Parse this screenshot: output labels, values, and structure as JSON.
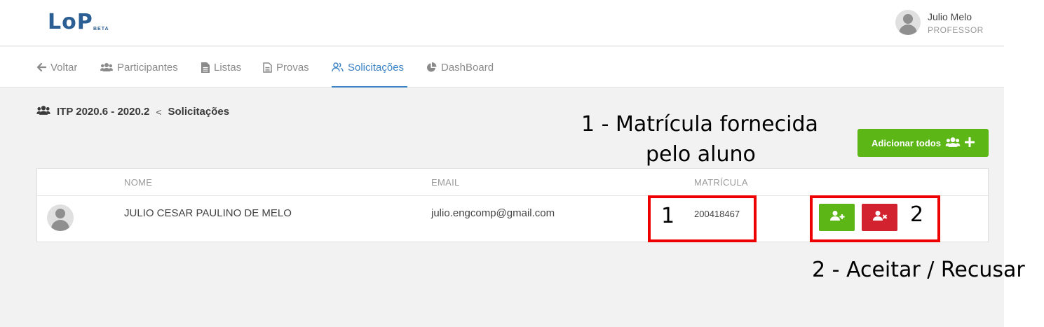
{
  "header": {
    "logo": "LoP",
    "logo_badge": "BETA",
    "user_name": "Julio Melo",
    "user_role": "PROFESSOR"
  },
  "nav": {
    "back": "Voltar",
    "participants": "Participantes",
    "lists": "Listas",
    "tests": "Provas",
    "requests": "Solicitações",
    "dashboard": "DashBoard"
  },
  "breadcrumb": {
    "course": "ITP 2020.6 - 2020.2",
    "separator": "<",
    "current": "Solicitações"
  },
  "actions": {
    "add_all": "Adicionar todos"
  },
  "table": {
    "columns": [
      "NOME",
      "EMAIL",
      "MATRÍCULA"
    ],
    "rows": [
      {
        "name": "JULIO CESAR PAULINO DE MELO",
        "email": "julio.engcomp@gmail.com",
        "matricula": "200418467"
      }
    ]
  },
  "annotations": {
    "note1_line1": "1 - Matrícula fornecida",
    "note1_line2": "pelo aluno",
    "marker1": "1",
    "marker2": "2",
    "note2": "2 - Aceitar / Recusar"
  },
  "colors": {
    "brand": "#2b5e93",
    "active_tab": "#3b82c4",
    "accept_green": "#5cb615",
    "reject_red": "#d22230",
    "annotation_red": "#ee0000"
  }
}
